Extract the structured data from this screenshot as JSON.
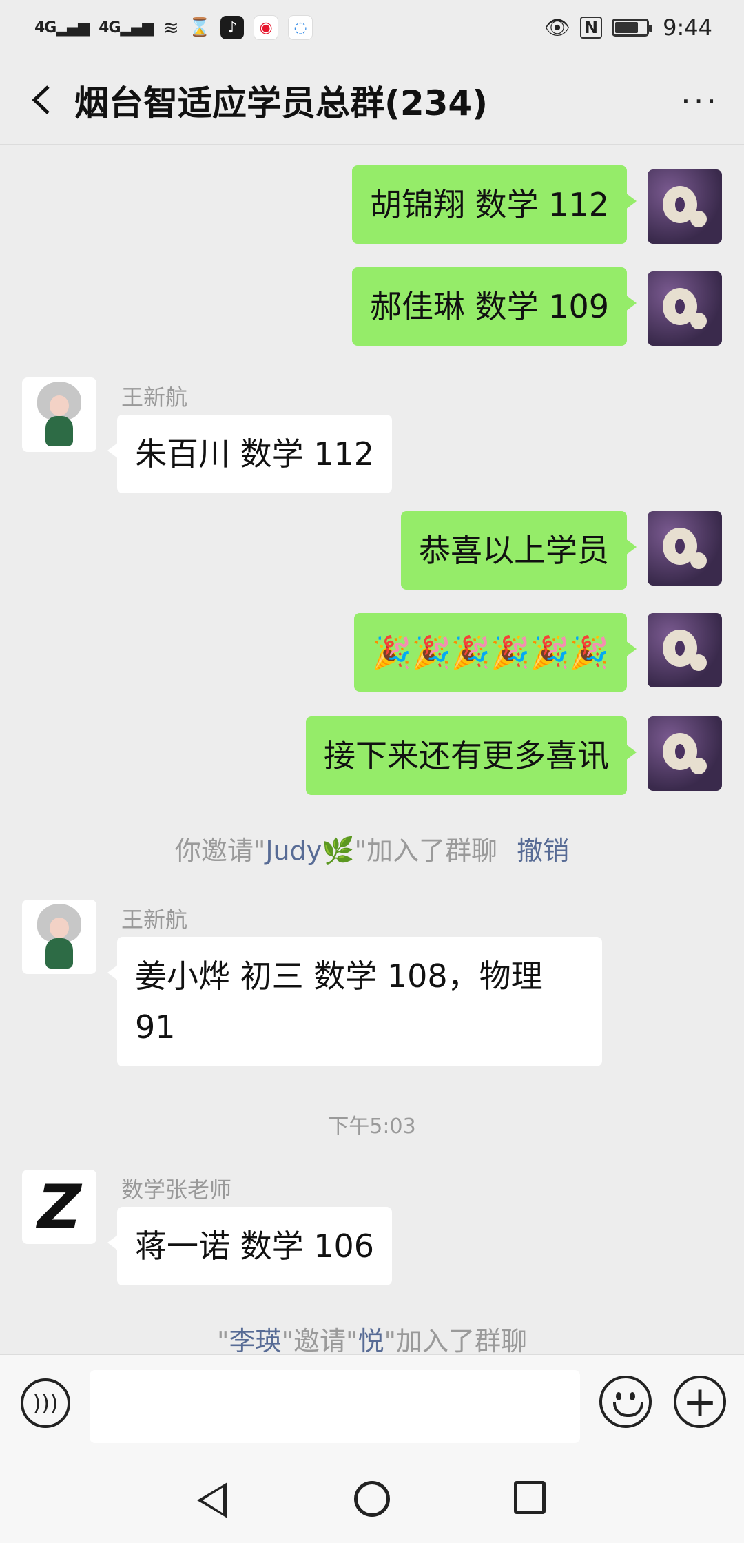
{
  "status_bar": {
    "signal1": "4G",
    "signal2": "4G",
    "time": "9:44",
    "nfc": "N",
    "battery_level": 0.75
  },
  "header": {
    "title": "烟台智适应学员总群(234)"
  },
  "messages": {
    "m1": "胡锦翔 数学 112",
    "m2": "郝佳琳 数学 109",
    "m3_sender": "王新航",
    "m3": "朱百川 数学 112",
    "m4": "恭喜以上学员",
    "m5": "🎉🎉🎉🎉🎉🎉",
    "m6": "接下来还有更多喜讯",
    "sys1_prefix": "你邀请\"",
    "sys1_name": "Judy🌿",
    "sys1_suffix": "\"加入了群聊",
    "sys1_action": "撤销",
    "m7_sender": "王新航",
    "m7": "姜小烨  初三  数学 108，物理 91",
    "timestamp": "下午5:03",
    "m8_sender": "数学张老师",
    "m8": "蒋一诺 数学 106",
    "sys2_q1": "\"",
    "sys2_name1": "李瑛",
    "sys2_mid": "\"邀请\"",
    "sys2_name2": "悦",
    "sys2_suffix": "\"加入了群聊"
  },
  "input": {
    "placeholder": ""
  },
  "colors": {
    "my_bubble": "#95ec69",
    "link": "#576b95"
  }
}
